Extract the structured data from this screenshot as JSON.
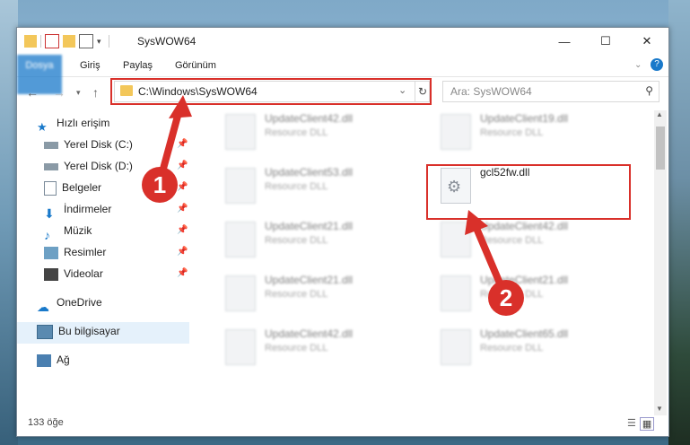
{
  "window": {
    "title": "SysWOW64"
  },
  "ribbon": {
    "tabs": [
      "Dosya",
      "Giriş",
      "Paylaş",
      "Görünüm"
    ]
  },
  "address": {
    "path": "C:\\Windows\\SysWOW64"
  },
  "search": {
    "placeholder": "Ara: SysWOW64"
  },
  "nav": {
    "items": [
      {
        "label": "Hızlı erişim",
        "icon": "star-icon"
      },
      {
        "label": "Yerel Disk (C:)",
        "icon": "drive-icon"
      },
      {
        "label": "Yerel Disk (D:)",
        "icon": "drive-icon"
      },
      {
        "label": "Belgeler",
        "icon": "document-icon"
      },
      {
        "label": "İndirmeler",
        "icon": "download-icon"
      },
      {
        "label": "Müzik",
        "icon": "music-icon"
      },
      {
        "label": "Resimler",
        "icon": "pictures-icon"
      },
      {
        "label": "Videolar",
        "icon": "video-icon"
      },
      {
        "label": "OneDrive",
        "icon": "cloud-icon"
      },
      {
        "label": "Bu bilgisayar",
        "icon": "computer-icon"
      },
      {
        "label": "Ağ",
        "icon": "network-icon"
      }
    ]
  },
  "files": [
    {
      "name": "UpdateClient42.dll",
      "type": "Resource DLL"
    },
    {
      "name": "UpdateClient19.dll",
      "type": "Resource DLL"
    },
    {
      "name": "UpdateClient53.dll",
      "type": "Resource DLL"
    },
    {
      "name": "gcl52fw.dll",
      "type": ""
    },
    {
      "name": "UpdateClient21.dll",
      "type": "Resource DLL"
    },
    {
      "name": "UpdateClient42.dll",
      "type": "Resource DLL"
    },
    {
      "name": "UpdateClient21.dll",
      "type": "Resource DLL"
    },
    {
      "name": "UpdateClient21.dll",
      "type": "Resource DLL"
    },
    {
      "name": "UpdateClient42.dll",
      "type": "Resource DLL"
    },
    {
      "name": "UpdateClient65.dll",
      "type": "Resource DLL"
    }
  ],
  "status": {
    "count": "133 öğe"
  },
  "callouts": [
    "1",
    "2"
  ],
  "colors": {
    "accent": "#1979ca",
    "highlight": "#d9302a"
  }
}
